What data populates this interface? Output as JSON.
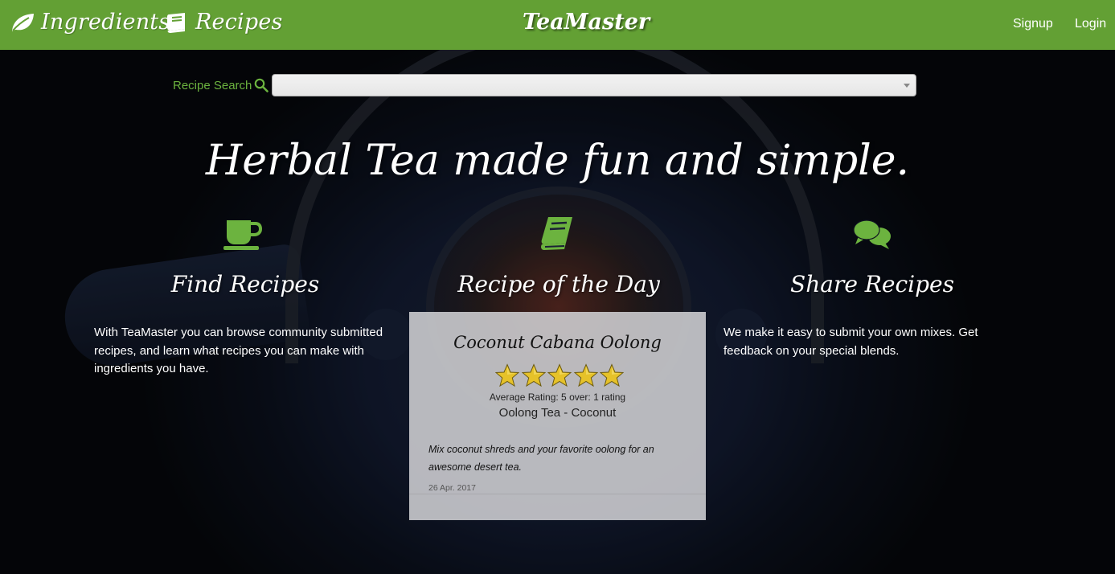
{
  "navbar": {
    "ingredients_label": "Ingredients",
    "recipes_label": "Recipes",
    "brand": "TeaMaster",
    "signup_label": "Signup",
    "login_label": "Login",
    "bg_color": "#63a034",
    "icons": {
      "ingredients": "leaf-icon",
      "recipes": "book-icon"
    }
  },
  "search": {
    "label": "Recipe Search",
    "icon": "search-icon",
    "value": ""
  },
  "hero": {
    "title": "Herbal Tea made fun and simple."
  },
  "columns": {
    "find": {
      "icon": "coffee-cup-icon",
      "heading": "Find Recipes",
      "text": "With TeaMaster you can browse community submitted recipes, and learn what recipes you can make with ingredients you have."
    },
    "day": {
      "icon": "book-icon",
      "heading": "Recipe of the Day"
    },
    "share": {
      "icon": "comments-icon",
      "heading": "Share Recipes",
      "text": "We make it easy to submit your own mixes. Get feedback on your special blends."
    }
  },
  "recipe_of_day": {
    "name": "Coconut Cabana Oolong",
    "stars": 5,
    "max_stars": 5,
    "rating_text": "Average Rating: 5 over: 1 rating",
    "subtitle": "Oolong Tea - Coconut",
    "description": "Mix coconut shreds and your favorite oolong for an awesome desert tea.",
    "date": "26 Apr. 2017"
  },
  "colors": {
    "accent_green": "#6cb33f",
    "star_gold": "#e6c229"
  }
}
